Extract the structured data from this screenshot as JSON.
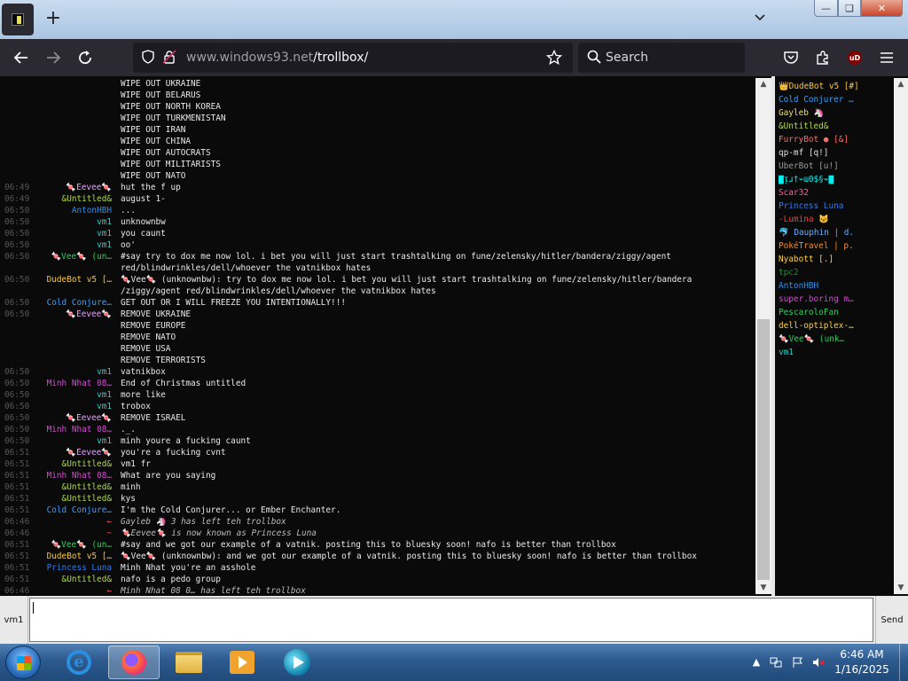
{
  "browser": {
    "url_host": "www.windows93.net",
    "url_path": "/trollbox/",
    "search_placeholder": "Search",
    "ublock_label": "uD"
  },
  "messages": [
    {
      "ts": "",
      "nick": "",
      "text": "WIPE OUT UKRAINE",
      "nick_color": "#eaeaea"
    },
    {
      "ts": "",
      "nick": "",
      "text": "WIPE OUT BELARUS",
      "nick_color": "#eaeaea"
    },
    {
      "ts": "",
      "nick": "",
      "text": "WIPE OUT NORTH KOREA",
      "nick_color": "#eaeaea"
    },
    {
      "ts": "",
      "nick": "",
      "text": "WIPE OUT TURKMENISTAN",
      "nick_color": "#eaeaea"
    },
    {
      "ts": "",
      "nick": "",
      "text": "WIPE OUT IRAN",
      "nick_color": "#eaeaea"
    },
    {
      "ts": "",
      "nick": "",
      "text": "WIPE OUT CHINA",
      "nick_color": "#eaeaea"
    },
    {
      "ts": "",
      "nick": "",
      "text": "WIPE OUT AUTOCRATS",
      "nick_color": "#eaeaea"
    },
    {
      "ts": "",
      "nick": "",
      "text": "WIPE OUT MILITARISTS",
      "nick_color": "#eaeaea"
    },
    {
      "ts": "",
      "nick": "",
      "text": "WIPE OUT NATO",
      "nick_color": "#eaeaea"
    },
    {
      "ts": "06:49",
      "nick": "🍬Eevee🍬",
      "text": "hut the f up",
      "nick_color": "#e7a2ff"
    },
    {
      "ts": "06:49",
      "nick": "&Untitled&",
      "text": "august 1-",
      "nick_color": "#b0d94a"
    },
    {
      "ts": "06:50",
      "nick": "AntonHBH",
      "text": "...",
      "nick_color": "#2e8ef0"
    },
    {
      "ts": "06:50",
      "nick": "vm1",
      "text": "unknownbw",
      "nick_color": "#26d0c8"
    },
    {
      "ts": "06:50",
      "nick": "vm1",
      "text": "you caunt",
      "nick_color": "#26d0c8"
    },
    {
      "ts": "06:50",
      "nick": "vm1",
      "text": "oo'",
      "nick_color": "#26d0c8"
    },
    {
      "ts": "06:50",
      "nick": "🍬Vee🍬 (un…",
      "text": "#say try to dox me now lol. i bet you will just start trashtalking on fune/zelensky/hitler/bandera/ziggy/agent",
      "nick_color": "#32d060"
    },
    {
      "ts": "",
      "nick": "",
      "text": "red/blindwrinkles/dell/whoever the vatnikbox hates",
      "nick_color": "#eaeaea"
    },
    {
      "ts": "06:50",
      "nick": "DudeBot v5 […",
      "text": "🍬Vee🍬 (unknownbw): try to dox me now lol. i bet you will just start trashtalking on fune/zelensky/hitler/bandera",
      "nick_color": "#ffc832"
    },
    {
      "ts": "",
      "nick": "",
      "text": "/ziggy/agent red/blindwrinkles/dell/whoever the vatnikbox hates",
      "nick_color": "#eaeaea"
    },
    {
      "ts": "06:50",
      "nick": "Cold Conjure…",
      "text": "GET OUT OR I WILL FREEZE YOU INTENTIONALLY!!!",
      "nick_color": "#3aa0ff"
    },
    {
      "ts": "06:50",
      "nick": "🍬Eevee🍬",
      "text": "REMOVE UKRAINE",
      "nick_color": "#e7a2ff"
    },
    {
      "ts": "",
      "nick": "",
      "text": "REMOVE EUROPE",
      "nick_color": "#eaeaea"
    },
    {
      "ts": "",
      "nick": "",
      "text": "REMOVE NATO",
      "nick_color": "#eaeaea"
    },
    {
      "ts": "",
      "nick": "",
      "text": "REMOVE USA",
      "nick_color": "#eaeaea"
    },
    {
      "ts": "",
      "nick": "",
      "text": "REMOVE TERRORISTS",
      "nick_color": "#eaeaea"
    },
    {
      "ts": "06:50",
      "nick": "vm1",
      "text": "vatnikbox",
      "nick_color": "#26d0c8"
    },
    {
      "ts": "06:50",
      "nick": "Minh Nhat 08…",
      "text": "End of Christmas untitled",
      "nick_color": "#d34bd3"
    },
    {
      "ts": "06:50",
      "nick": "vm1",
      "text": "more like",
      "nick_color": "#26d0c8"
    },
    {
      "ts": "06:50",
      "nick": "vm1",
      "text": "trobox",
      "nick_color": "#26d0c8"
    },
    {
      "ts": "06:50",
      "nick": "🍬Eevee🍬",
      "text": "REMOVE ISRAEL",
      "nick_color": "#e7a2ff"
    },
    {
      "ts": "06:50",
      "nick": "Minh Nhat 08…",
      "text": "._.",
      "nick_color": "#d34bd3"
    },
    {
      "ts": "06:50",
      "nick": "vm1",
      "text": "minh youre a fucking caunt",
      "nick_color": "#26d0c8"
    },
    {
      "ts": "06:51",
      "nick": "🍬Eevee🍬",
      "text": "you're a fucking cvnt",
      "nick_color": "#e7a2ff"
    },
    {
      "ts": "06:51",
      "nick": "&Untitled&",
      "text": "vm1 fr",
      "nick_color": "#b0d94a"
    },
    {
      "ts": "06:51",
      "nick": "Minh Nhat 08…",
      "text": "What are you saying",
      "nick_color": "#d34bd3"
    },
    {
      "ts": "06:51",
      "nick": "&Untitled&",
      "text": "minh",
      "nick_color": "#b0d94a"
    },
    {
      "ts": "06:51",
      "nick": "&Untitled&",
      "text": "kys",
      "nick_color": "#b0d94a"
    },
    {
      "ts": "06:51",
      "nick": "Cold Conjure…",
      "text": "I'm the Cold Conjurer... or Ember Enchanter.",
      "nick_color": "#3aa0ff"
    },
    {
      "ts": "06:46",
      "nick": "←",
      "text": "Gayleb 🦄 3 has left teh trollbox",
      "nick_color": "#ff4b4b",
      "sys": true
    },
    {
      "ts": "06:46",
      "nick": "~",
      "text": "🍬Eevee🍬 is now known as Princess Luna",
      "nick_color": "#ff4b4b",
      "sys": true
    },
    {
      "ts": "06:51",
      "nick": "🍬Vee🍬 (un…",
      "text": "#say and we got our example of a vatnik. posting this to bluesky soon! nafo is better than trollbox",
      "nick_color": "#32d060"
    },
    {
      "ts": "06:51",
      "nick": "DudeBot v5 […",
      "text": "🍬Vee🍬 (unknownbw): and we got our example of a vatnik. posting this to bluesky soon! nafo is better than trollbox",
      "nick_color": "#ffc832"
    },
    {
      "ts": "06:51",
      "nick": "Princess Luna",
      "text": "Minh Nhat you're an asshole",
      "nick_color": "#2e7cf0"
    },
    {
      "ts": "06:51",
      "nick": "&Untitled&",
      "text": "nafo is a pedo group",
      "nick_color": "#b0d94a"
    },
    {
      "ts": "06:46",
      "nick": "←",
      "text": "Minh Nhat 08 0… has left teh trollbox",
      "nick_color": "#ff4b4b",
      "sys": true
    }
  ],
  "users": [
    {
      "name": "👑DudeBot v5 [#]",
      "color": "#ffc832"
    },
    {
      "name": "Cold Conjurer …",
      "color": "#3aa0ff"
    },
    {
      "name": "Gayleb 🦄",
      "color": "#f0e060"
    },
    {
      "name": "&Untitled&",
      "color": "#b0d94a"
    },
    {
      "name": "FurryBot ● [&]",
      "color": "#ff6a6a"
    },
    {
      "name": "qp-mf [q!]",
      "color": "#e0e0e0"
    },
    {
      "name": "UberBot [u!]",
      "color": "#9a9a9a"
    },
    {
      "name": "▇ᴉɹ†⌁ɯ0$§⌁▇",
      "color": "#00f0f0"
    },
    {
      "name": "Scar32",
      "color": "#ff5fa0"
    },
    {
      "name": "Princess Luna",
      "color": "#2e7cf0"
    },
    {
      "name": "-Lumina 🐱",
      "color": "#ff3b3b"
    },
    {
      "name": "🐬 Dauphin | d.",
      "color": "#6ab0ff"
    },
    {
      "name": "PokéTravel | p.",
      "color": "#ff8a2a"
    },
    {
      "name": "Nyabott [.]",
      "color": "#ffd23a"
    },
    {
      "name": "tpc2",
      "color": "#1f8f3a"
    },
    {
      "name": "AntonHBH",
      "color": "#2e8ef0"
    },
    {
      "name": "super.boring m…",
      "color": "#d34bd3"
    },
    {
      "name": "PescaroloFan",
      "color": "#32d060"
    },
    {
      "name": "dell-optiplex-…",
      "color": "#ffd23a"
    },
    {
      "name": "🍬Vee🍬 (unk…",
      "color": "#32d060"
    },
    {
      "name": "vm1",
      "color": "#26d0c8"
    }
  ],
  "input": {
    "nick_label": "vm1",
    "value": "",
    "send_label": "Send"
  },
  "taskbar": {
    "time": "6:46 AM",
    "date": "1/16/2025"
  }
}
